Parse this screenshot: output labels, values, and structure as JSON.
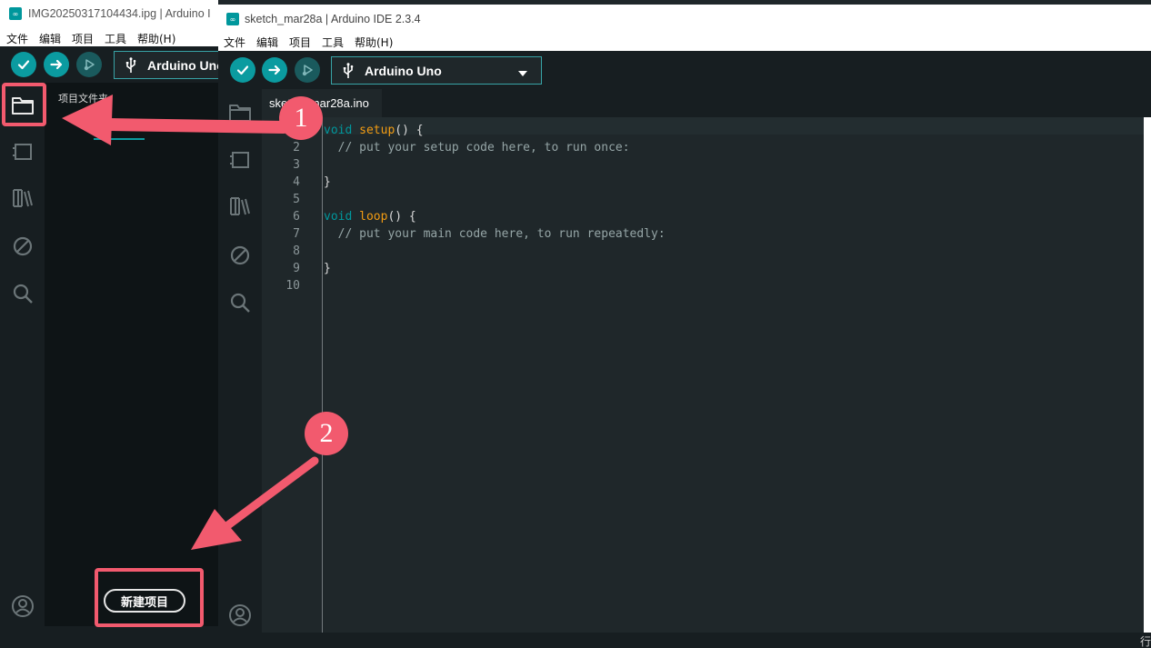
{
  "back_window": {
    "title": "IMG20250317104434.ipg | Arduino I",
    "menu": [
      "文件",
      "编辑",
      "项目",
      "工具",
      "帮助(H)"
    ],
    "board": "Arduino Uno",
    "panel_title": "项目文件夹",
    "new_project_button": "新建项目"
  },
  "front_window": {
    "title": "sketch_mar28a | Arduino IDE 2.3.4",
    "menu": [
      "文件",
      "编辑",
      "项目",
      "工具",
      "帮助(H)"
    ],
    "board": "Arduino Uno",
    "tab_label": "sketch_mar28a.ino",
    "status_right": "行"
  },
  "code": [
    {
      "n": "1",
      "segs": [
        {
          "t": "void",
          "c": "kw"
        },
        {
          "t": " ",
          "c": ""
        },
        {
          "t": "setup",
          "c": "fn"
        },
        {
          "t": "() {",
          "c": ""
        }
      ]
    },
    {
      "n": "2",
      "segs": [
        {
          "t": "  // put your setup code here, to run once:",
          "c": "cm"
        }
      ]
    },
    {
      "n": "3",
      "segs": []
    },
    {
      "n": "4",
      "segs": [
        {
          "t": "}",
          "c": ""
        }
      ]
    },
    {
      "n": "5",
      "segs": []
    },
    {
      "n": "6",
      "segs": [
        {
          "t": "void",
          "c": "kw"
        },
        {
          "t": " ",
          "c": ""
        },
        {
          "t": "loop",
          "c": "fn"
        },
        {
          "t": "() {",
          "c": ""
        }
      ]
    },
    {
      "n": "7",
      "segs": [
        {
          "t": "  // put your main code here, to run repeatedly:",
          "c": "cm"
        }
      ]
    },
    {
      "n": "8",
      "segs": []
    },
    {
      "n": "9",
      "segs": [
        {
          "t": "}",
          "c": ""
        }
      ]
    },
    {
      "n": "10",
      "segs": []
    }
  ],
  "annotations": {
    "step1": "1",
    "step2": "2",
    "accent_color": "#f25a6e"
  },
  "colors": {
    "teal": "#0b9ba0",
    "bg_dark": "#171e21",
    "editor_bg": "#1f272a",
    "keyword": "#00979c",
    "function": "#f39c12",
    "comment": "#95a5a6"
  }
}
